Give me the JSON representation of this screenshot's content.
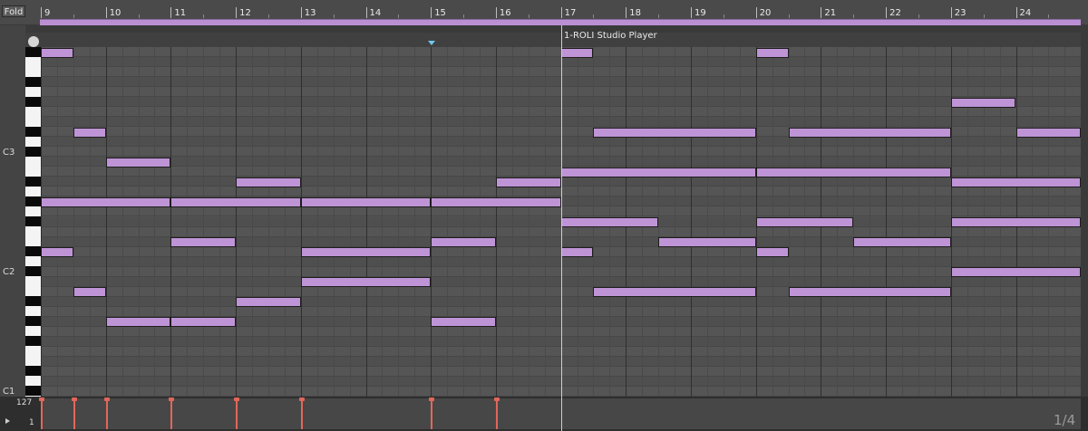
{
  "toolbar": {
    "fold_label": "Fold"
  },
  "ruler": {
    "bars": [
      "9",
      "10",
      "11",
      "12",
      "13",
      "14",
      "15",
      "16",
      "17",
      "18",
      "19",
      "20",
      "21",
      "22",
      "23",
      "24"
    ]
  },
  "clip": {
    "name": "1-ROLI Studio Player"
  },
  "piano": {
    "labels": [
      "C3",
      "C2",
      "C1"
    ]
  },
  "velocity": {
    "max_label": "127",
    "min_label": "1"
  },
  "page_indicator": "1/4",
  "colors": {
    "note": "#bf94d6",
    "loop_bar": "#bb8fd3",
    "velocity": "#e2675a",
    "grid_bg": "#555555",
    "start_marker": "#6fc8ef"
  }
}
